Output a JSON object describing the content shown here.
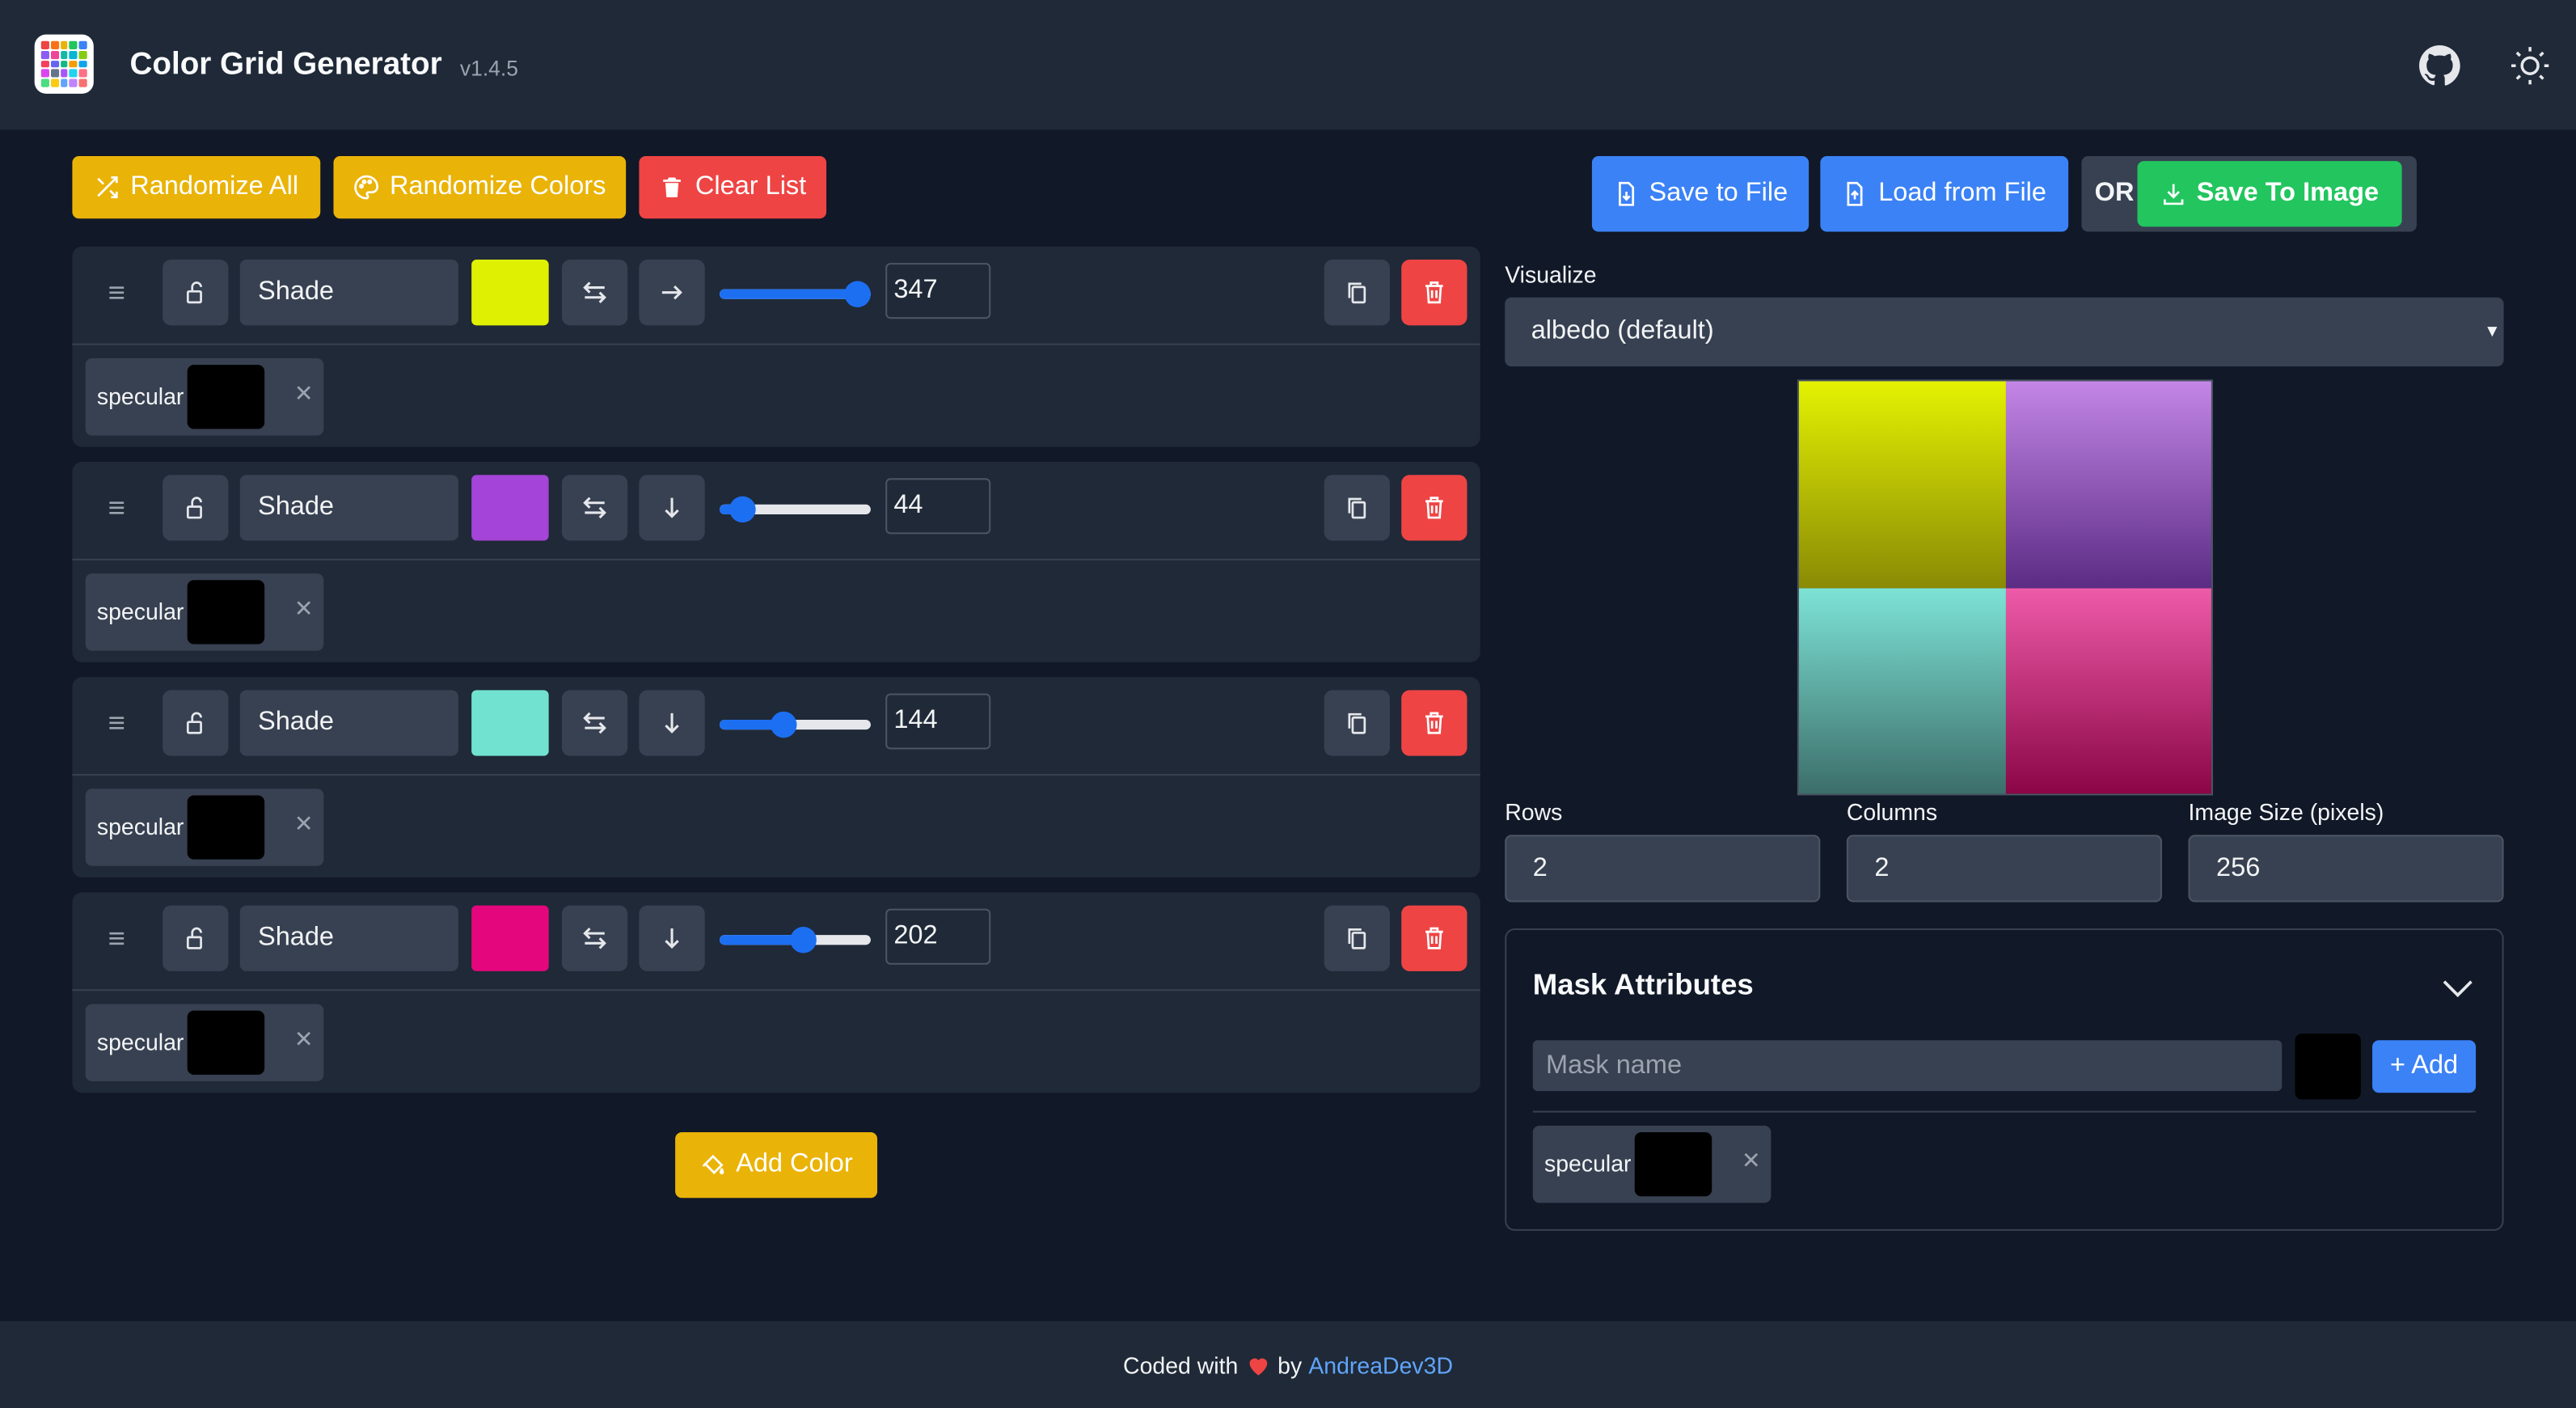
{
  "header": {
    "title": "Color Grid Generator",
    "version": "v1.4.5",
    "logo_icon": "color-grid-logo",
    "github_icon": "github-icon",
    "theme_icon": "sun-icon"
  },
  "toolbar": {
    "randomize_all": "Randomize All",
    "randomize_colors": "Randomize Colors",
    "clear_list": "Clear List",
    "add_color": "Add Color"
  },
  "file_actions": {
    "save_to_file": "Save to File",
    "load_from_file": "Load from File",
    "or": "OR",
    "save_to_image": "Save To Image"
  },
  "colors": [
    {
      "name": "Shade",
      "color": "#e0f002",
      "direction": "right",
      "value": "347",
      "fraction": 0.91,
      "mask_label": "specular",
      "mask_color": "#000000"
    },
    {
      "name": "Shade",
      "color": "#a444d8",
      "direction": "down",
      "value": "44",
      "fraction": 0.15,
      "mask_label": "specular",
      "mask_color": "#000000"
    },
    {
      "name": "Shade",
      "color": "#72e2d0",
      "direction": "down",
      "value": "144",
      "fraction": 0.42,
      "mask_label": "specular",
      "mask_color": "#000000"
    },
    {
      "name": "Shade",
      "color": "#e3067c",
      "direction": "down",
      "value": "202",
      "fraction": 0.55,
      "mask_label": "specular",
      "mask_color": "#000000"
    }
  ],
  "visualize": {
    "label": "Visualize",
    "selected": "albedo (default)"
  },
  "preview": {
    "cells": [
      {
        "top": "#e4f202",
        "bottom": "#8a8a05"
      },
      {
        "top": "#c386e6",
        "bottom": "#5b2c84"
      },
      {
        "top": "#7de3d6",
        "bottom": "#3c6e6a"
      },
      {
        "top": "#ee5ba8",
        "bottom": "#8b0647"
      }
    ]
  },
  "grid_settings": {
    "rows_label": "Rows",
    "rows": "2",
    "columns_label": "Columns",
    "columns": "2",
    "size_label": "Image Size (pixels)",
    "size": "256"
  },
  "mask_attributes": {
    "title": "Mask Attributes",
    "placeholder": "Mask name",
    "add_label": "+ Add",
    "items": [
      {
        "label": "specular",
        "color": "#000000"
      }
    ]
  },
  "footer": {
    "prefix": "Coded with",
    "by": "by",
    "author": "AndreaDev3D"
  }
}
